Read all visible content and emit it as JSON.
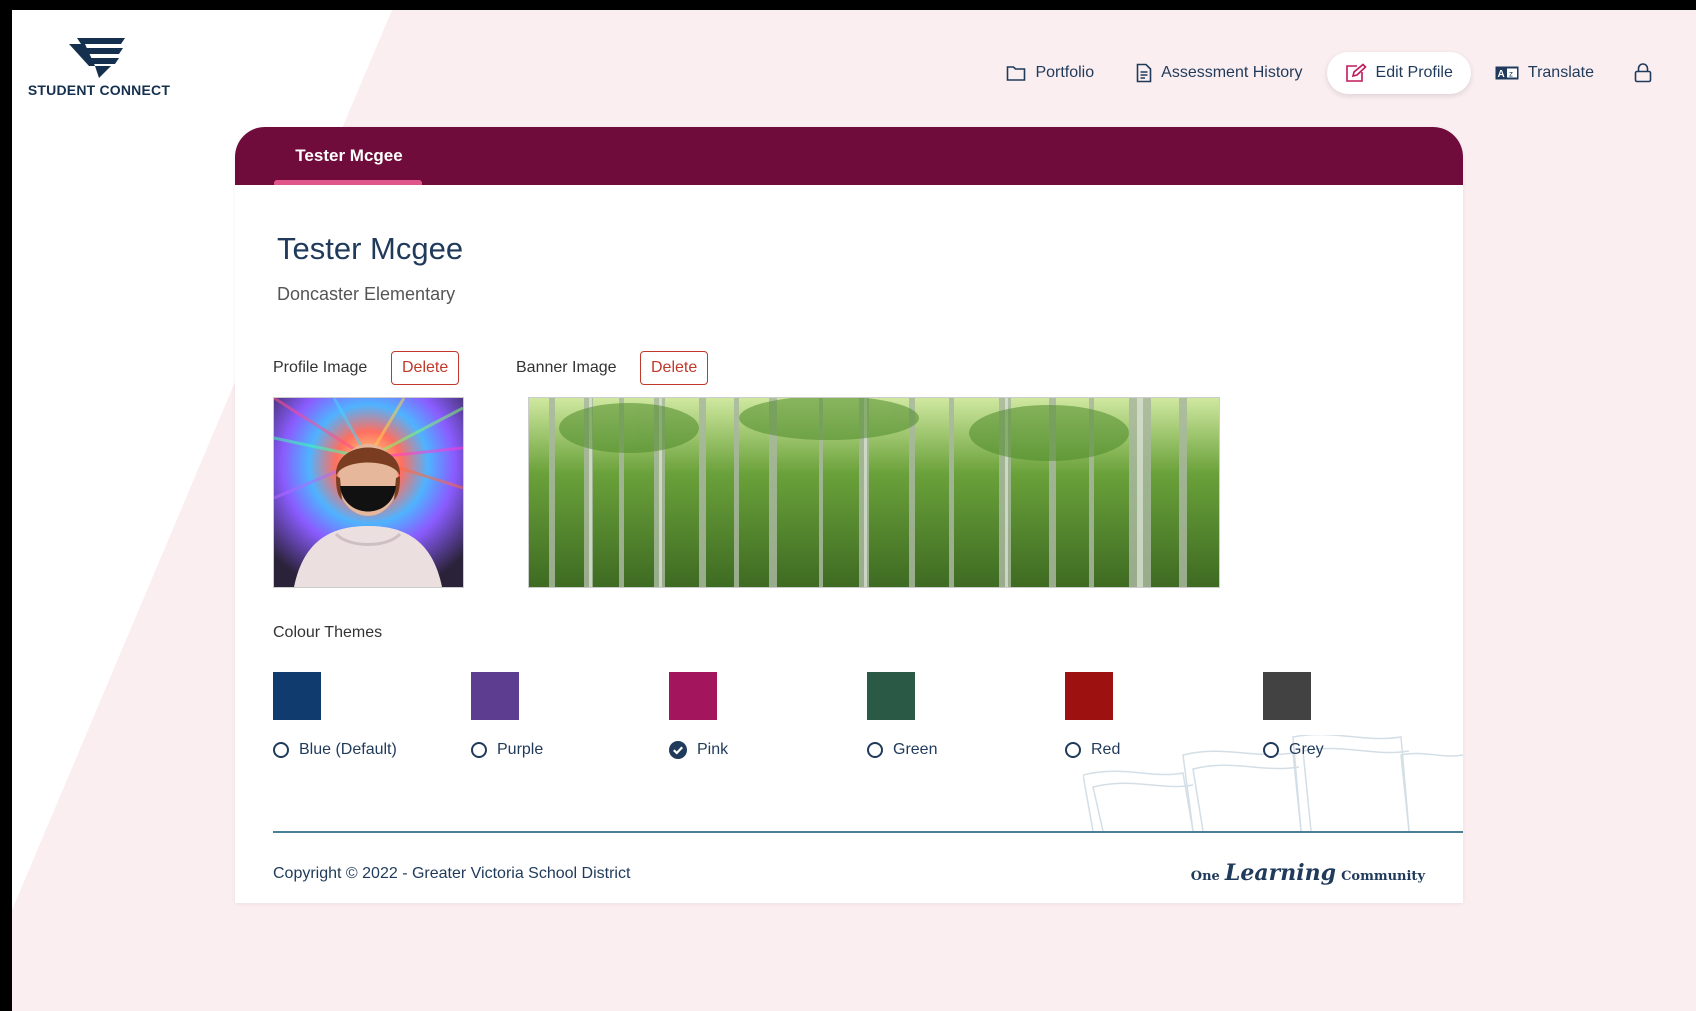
{
  "app": {
    "logo_text": "STUDENT CONNECT"
  },
  "nav": {
    "items": [
      {
        "label": "Portfolio",
        "icon": "folder-icon"
      },
      {
        "label": "Assessment History",
        "icon": "document-icon"
      },
      {
        "label": "Edit Profile",
        "icon": "edit-icon",
        "active": true
      },
      {
        "label": "Translate",
        "icon": "translate-icon"
      }
    ],
    "lock_icon": "lock-icon"
  },
  "card": {
    "tab_label": "Tester Mcgee",
    "student_name": "Tester Mcgee",
    "school": "Doncaster Elementary",
    "profile_image_label": "Profile Image",
    "banner_image_label": "Banner Image",
    "delete_label": "Delete",
    "colour_themes_label": "Colour Themes",
    "themes": [
      {
        "label": "Blue (Default)",
        "color": "#0f3b6e",
        "selected": false
      },
      {
        "label": "Purple",
        "color": "#5c3d8f",
        "selected": false
      },
      {
        "label": "Pink",
        "color": "#a3155c",
        "selected": true
      },
      {
        "label": "Green",
        "color": "#2a5a45",
        "selected": false
      },
      {
        "label": "Red",
        "color": "#9e1111",
        "selected": false
      },
      {
        "label": "Grey",
        "color": "#424242",
        "selected": false
      }
    ]
  },
  "footer": {
    "copyright": "Copyright © 2022 - Greater Victoria School District",
    "brand_one": "One",
    "brand_learning": "Learning",
    "brand_community": "Community"
  },
  "colors": {
    "header_bg": "#700c3b",
    "tab_underline": "#e0568a",
    "text": "#1f3a5a",
    "delete": "#c0392b"
  }
}
